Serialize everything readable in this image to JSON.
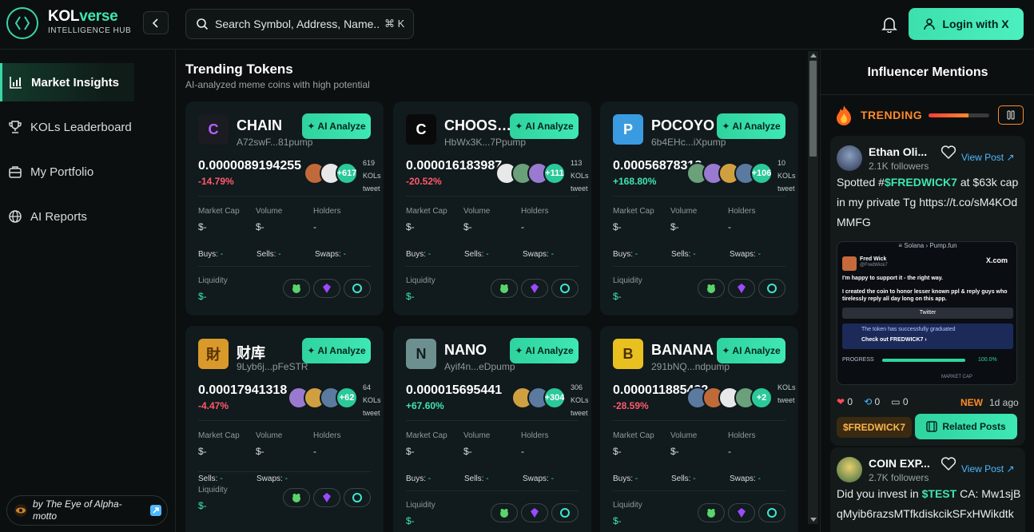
{
  "brand": {
    "name_main": "KOL",
    "name_accent": "verse",
    "subtitle": "INTELLIGENCE HUB"
  },
  "search": {
    "placeholder": "Search Symbol, Address, Name...",
    "shortcut": "⌘ K"
  },
  "header": {
    "login_label": "Login with X"
  },
  "sidebar": {
    "items": [
      {
        "label": "Market Insights",
        "icon": "bar-chart-icon",
        "active": true
      },
      {
        "label": "KOLs Leaderboard",
        "icon": "trophy-icon",
        "active": false
      },
      {
        "label": "My Portfolio",
        "icon": "briefcase-icon",
        "active": false
      },
      {
        "label": "AI Reports",
        "icon": "globe-icon",
        "active": false
      }
    ],
    "credit": "by The Eye of Alpha-motto"
  },
  "main": {
    "title": "Trending Tokens",
    "subtitle": "AI-analyzed meme coins with high potential",
    "ai_label": "AI Analyze",
    "labels": {
      "market_cap": "Market Cap",
      "volume": "Volume",
      "holders": "Holders",
      "buys": "Buys:",
      "sells": "Sells:",
      "swaps": "Swaps:",
      "liquidity": "Liquidity"
    },
    "cards": [
      {
        "name": "CHAIN",
        "address": "A72swF...81pump",
        "price": "0.0000089194255",
        "change": "-14.79%",
        "trend": "neg",
        "more": "+617",
        "kols_count": "619",
        "market_cap": "$-",
        "volume": "$-",
        "holders": "-",
        "buys": "-",
        "sells": "-",
        "swaps": "-",
        "liquidity": "$-",
        "img_bg": "#1b1b22",
        "img_glyph": "C",
        "img_color": "#b660ff",
        "avatars": 2,
        "show_buys": true
      },
      {
        "name": "CHOOSE...",
        "address": "HbWx3K...7Ppump",
        "price": "0.000016183987",
        "change": "-20.52%",
        "trend": "neg",
        "more": "+111",
        "kols_count": "113",
        "market_cap": "$-",
        "volume": "$-",
        "holders": "-",
        "buys": "-",
        "sells": "-",
        "swaps": "-",
        "liquidity": "$-",
        "img_bg": "#0a0a0a",
        "img_glyph": "C",
        "img_color": "#ffffff",
        "avatars": 3,
        "show_buys": true
      },
      {
        "name": "POCOYO",
        "address": "6b4EHc...iXpump",
        "price": "0.00056878318",
        "change": "+168.80%",
        "trend": "pos",
        "more": "+106",
        "kols_count": "10",
        "market_cap": "$-",
        "volume": "$-",
        "holders": "-",
        "buys": "-",
        "sells": "-",
        "swaps": "-",
        "liquidity": "$-",
        "img_bg": "#3b9be0",
        "img_glyph": "P",
        "img_color": "#ffffff",
        "avatars": 4,
        "show_buys": true
      },
      {
        "name": "财库",
        "address": "9Lyb6j...pFeSTR",
        "price": "0.00017941318",
        "change": "-4.47%",
        "trend": "neg",
        "more": "+62",
        "kols_count": "64",
        "market_cap": "$-",
        "volume": "$-",
        "holders": "-",
        "buys": "-",
        "sells": "-",
        "swaps": "-",
        "liquidity": "$-",
        "img_bg": "#d99a2b",
        "img_glyph": "財",
        "img_color": "#5a3300",
        "avatars": 3,
        "show_buys": false
      },
      {
        "name": "NANO",
        "address": "Ayif4n...eDpump",
        "price": "0.000015695441",
        "change": "+67.60%",
        "trend": "pos",
        "more": "+304",
        "kols_count": "306",
        "market_cap": "$-",
        "volume": "$-",
        "holders": "-",
        "buys": "-",
        "sells": "-",
        "swaps": "-",
        "liquidity": "$-",
        "img_bg": "#6e8f90",
        "img_glyph": "N",
        "img_color": "#102020",
        "avatars": 2,
        "show_buys": true
      },
      {
        "name": "BANANA",
        "address": "291bNQ...ndpump",
        "price": "0.000011885432",
        "change": "-28.59%",
        "trend": "neg",
        "more": "+2",
        "kols_count": "",
        "market_cap": "$-",
        "volume": "$-",
        "holders": "-",
        "buys": "-",
        "sells": "-",
        "swaps": "-",
        "liquidity": "$-",
        "img_bg": "#e8c020",
        "img_glyph": "B",
        "img_color": "#4a3000",
        "avatars": 4,
        "show_buys": true
      }
    ],
    "kols_word": "KOLs",
    "tweets_word": "tweet"
  },
  "right_panel": {
    "title": "Influencer Mentions",
    "trending_label": "TRENDING",
    "trending_level": 0.65,
    "posts": [
      {
        "name": "Ethan Oli...",
        "followers": "2.1K followers",
        "view_post": "View Post ↗",
        "text_pre": "Spotted #",
        "token": "$FREDWICK7",
        "text_post": " at $63k cap in my private Tg https://t.co/sM4KOdMMFG",
        "likes": "0",
        "retweets": "0",
        "replies": "0",
        "new_label": "NEW",
        "ago": "1d ago",
        "tag": "$FREDWICK7",
        "related": "Related Posts",
        "img": {
          "tabs": "≡ Solana  ›  Pump.fun",
          "author": "Fred Wick",
          "handle": "@FredWick7",
          "brand": "X.com",
          "line1": "I'm happy to support it - the right way.",
          "line2": "I created the coin to honor lesser known ppl & reply guys who tirelessly reply all day long on this app.",
          "twitter": "Twitter",
          "note": "The token has successfully graduated",
          "check": "Check out FREDWICK7 ›",
          "progress_label": "PROGRESS",
          "progress": "100.0%",
          "progress_value": 1.0,
          "mcap_label": "MARKET CAP"
        }
      },
      {
        "name": "COIN EXP...",
        "followers": "2.7K followers",
        "view_post": "View Post ↗",
        "text_pre": "Did you invest in ",
        "token": "$TEST",
        "text_post": " CA: Mw1sjBqMyib6razsMTfkdiskcikSFxHWikdtk"
      }
    ]
  }
}
